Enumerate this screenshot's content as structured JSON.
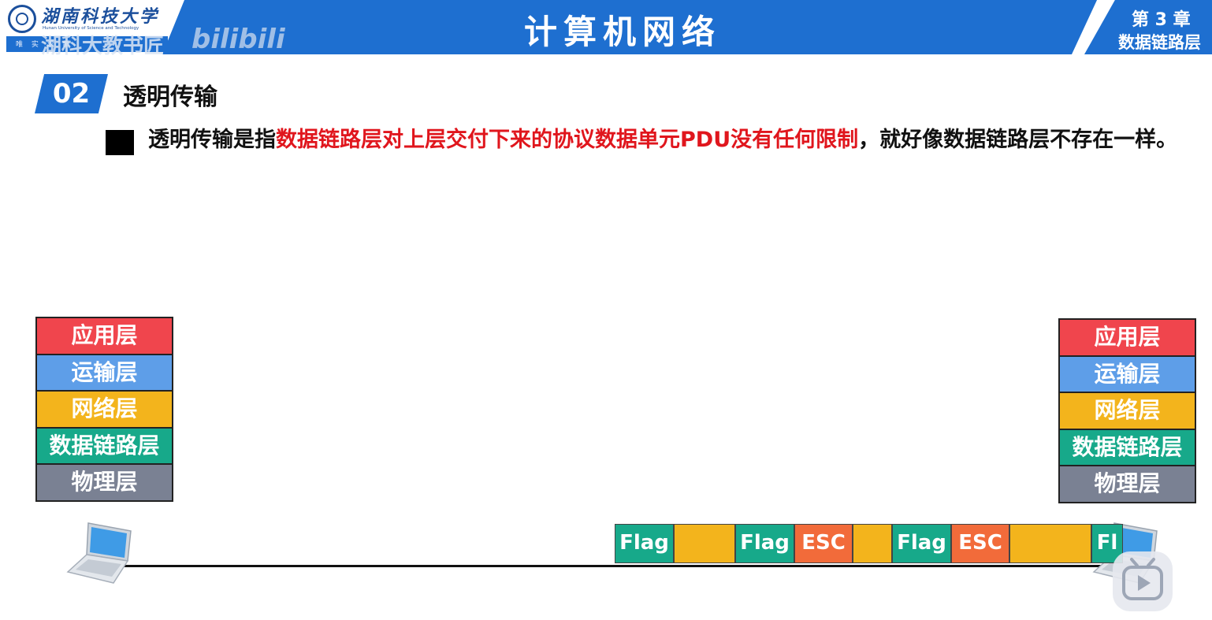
{
  "header": {
    "university_name_cn": "湖南科技大学",
    "university_name_en": "Hunan University of Science and Technology",
    "university_motto": "唯 实 求 新",
    "watermark_text": "湖科大教书匠",
    "watermark_brand": "bilibili",
    "title": "计算机网络",
    "chapter_number": "第 3 章",
    "chapter_name": "数据链路层"
  },
  "section": {
    "number": "02",
    "title": "透明传输"
  },
  "bullet": {
    "text_before": "透明传输是指",
    "text_highlight": "数据链路层对上层交付下来的协议数据单元PDU没有任何限制",
    "text_after": "，就好像数据链路层不存在一样。",
    "highlight_color": "#e0161d"
  },
  "stacks": {
    "left": [
      {
        "label": "应用层",
        "color": "#f0454d"
      },
      {
        "label": "运输层",
        "color": "#5e9ee8"
      },
      {
        "label": "网络层",
        "color": "#f3b41c"
      },
      {
        "label": "数据链路层",
        "color": "#17a98a"
      },
      {
        "label": "物理层",
        "color": "#7a8193"
      }
    ],
    "right": [
      {
        "label": "应用层",
        "color": "#f0454d"
      },
      {
        "label": "运输层",
        "color": "#5e9ee8"
      },
      {
        "label": "网络层",
        "color": "#f3b41c"
      },
      {
        "label": "数据链路层",
        "color": "#17a98a"
      },
      {
        "label": "物理层",
        "color": "#7a8193"
      }
    ]
  },
  "frame": {
    "segments": [
      {
        "label": "Flag",
        "color": "#17a98a",
        "w": 75
      },
      {
        "label": "",
        "color": "#f3b41c",
        "w": 78
      },
      {
        "label": "Flag",
        "color": "#17a98a",
        "w": 75
      },
      {
        "label": "ESC",
        "color": "#f26b3a",
        "w": 74
      },
      {
        "label": "",
        "color": "#f3b41c",
        "w": 50
      },
      {
        "label": "Flag",
        "color": "#17a98a",
        "w": 75
      },
      {
        "label": "ESC",
        "color": "#f26b3a",
        "w": 74
      },
      {
        "label": "",
        "color": "#f3b41c",
        "w": 104
      },
      {
        "label": "Fl",
        "color": "#17a98a",
        "w": 40
      }
    ]
  },
  "colors": {
    "header_blue": "#1e6fd0"
  }
}
